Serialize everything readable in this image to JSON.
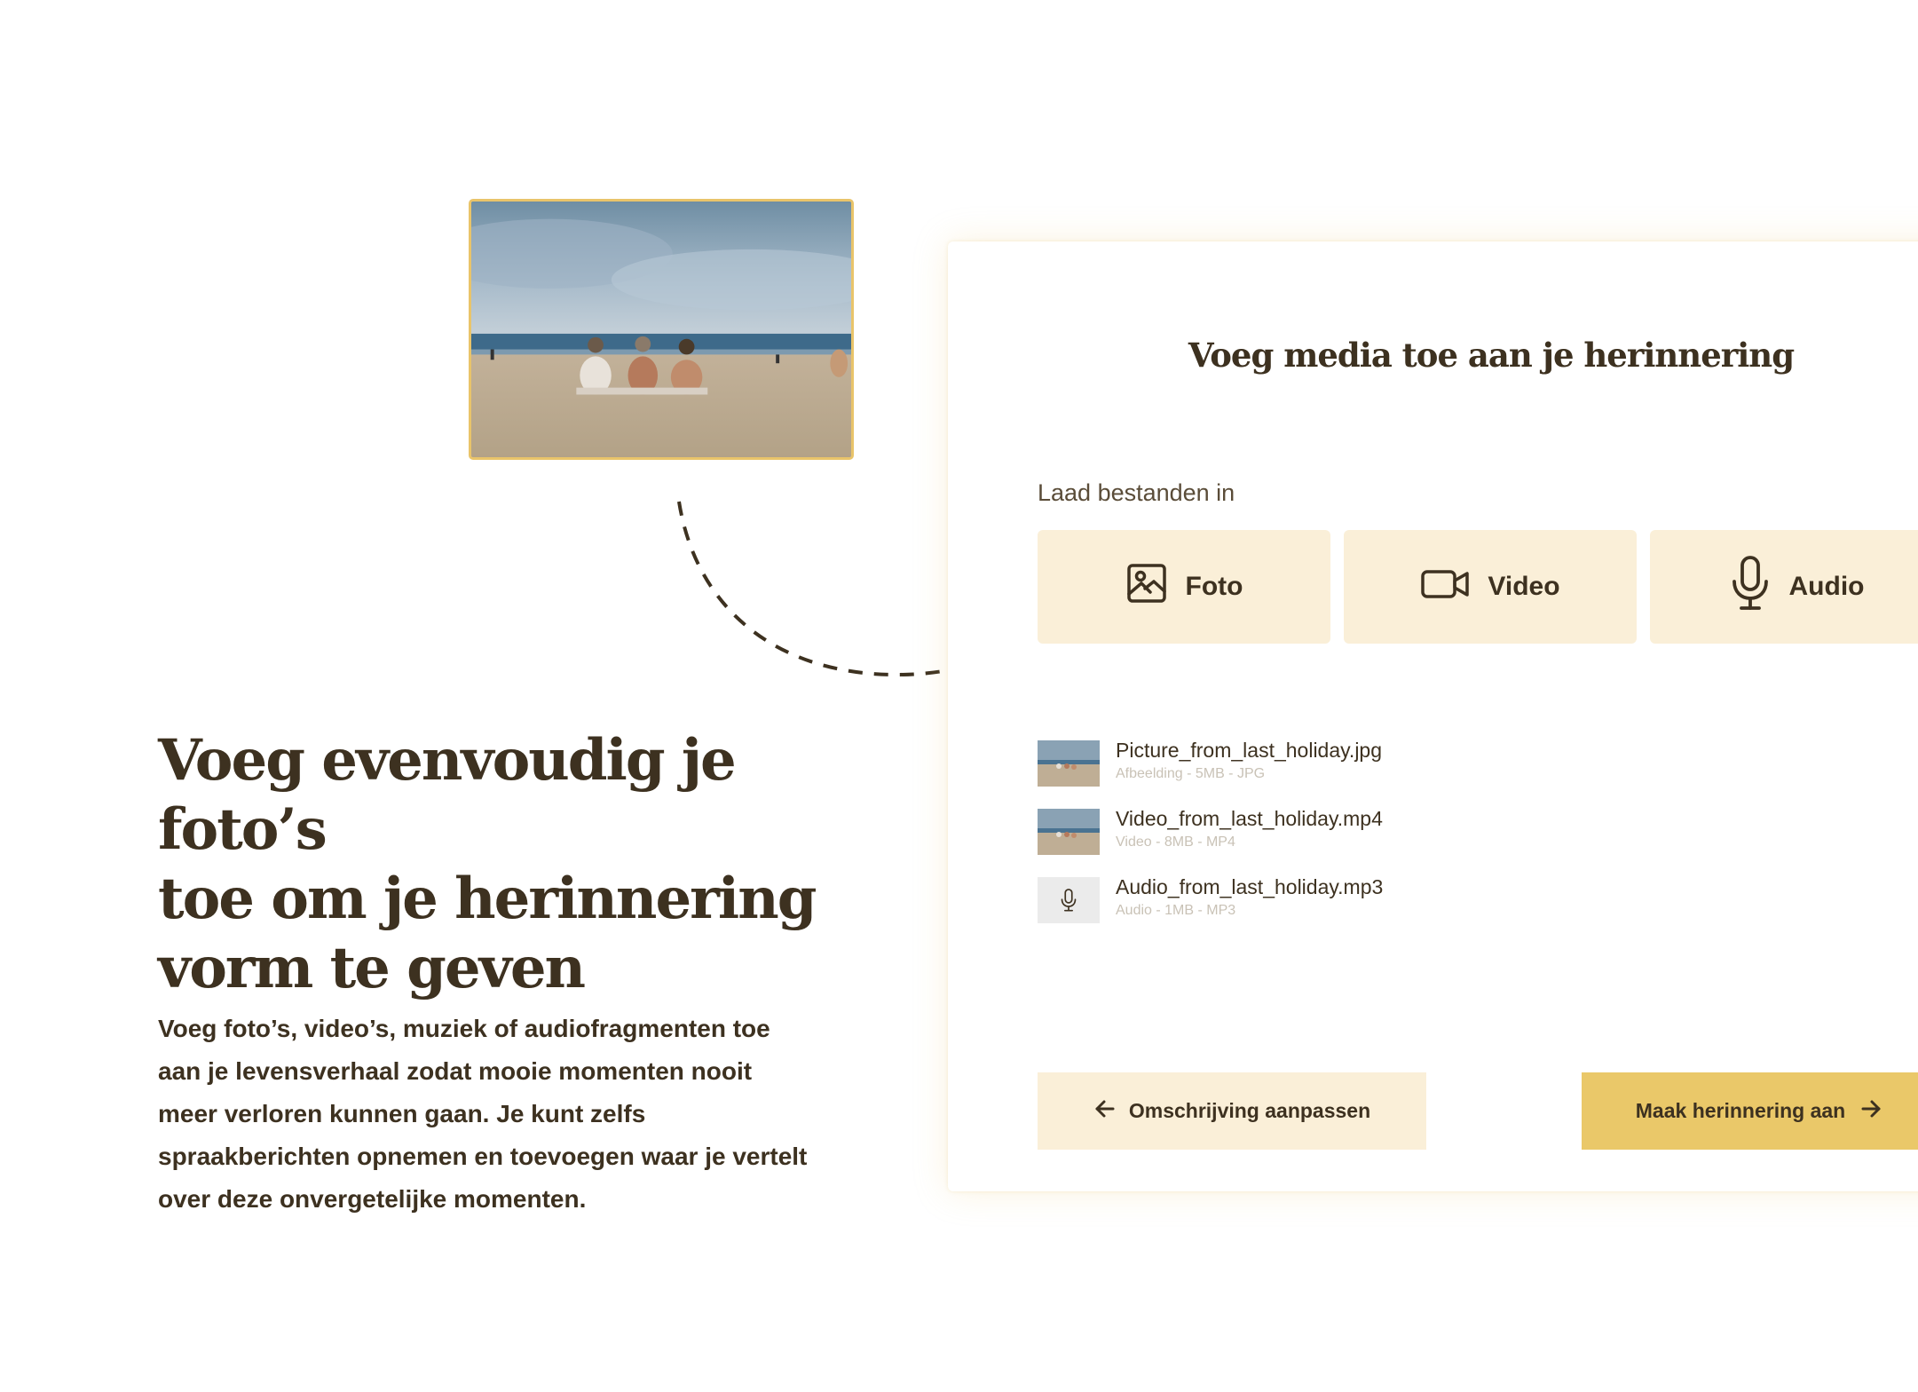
{
  "hero": {
    "title_line1": "Voeg evenvoudig je foto’s",
    "title_line2": "toe om je herinnering",
    "title_line3": "vorm te geven",
    "body": "Voeg foto’s, video’s, muziek of audiofragmenten toe aan je levensverhaal zodat mooie momenten nooit meer verloren kunnen gaan. Je kunt zelfs spraakberichten opnemen en toevoegen waar je vertelt over deze onvergetelijke momenten."
  },
  "card": {
    "title": "Voeg media toe aan je herinnering",
    "upload_label": "Laad bestanden in",
    "media_buttons": [
      {
        "label": "Foto",
        "icon": "image-icon"
      },
      {
        "label": "Video",
        "icon": "video-camera-icon"
      },
      {
        "label": "Audio",
        "icon": "microphone-icon"
      }
    ],
    "files": [
      {
        "name": "Picture_from_last_holiday.jpg",
        "meta": "Afbeelding - 5MB - JPG",
        "thumb": "beach-thumbnail"
      },
      {
        "name": "Video_from_last_holiday.mp4",
        "meta": "Video - 8MB - MP4",
        "thumb": "beach-thumbnail"
      },
      {
        "name": "Audio_from_last_holiday.mp3",
        "meta": "Audio - 1MB - MP3",
        "thumb": "microphone-icon"
      }
    ],
    "back_button": "Omschrijving aanpassen",
    "create_button": "Maak herinnering aan"
  },
  "colors": {
    "text": "#3d3120",
    "accent": "#eac869",
    "light_accent": "#faefd8",
    "meta_text": "#c9c2b6"
  }
}
